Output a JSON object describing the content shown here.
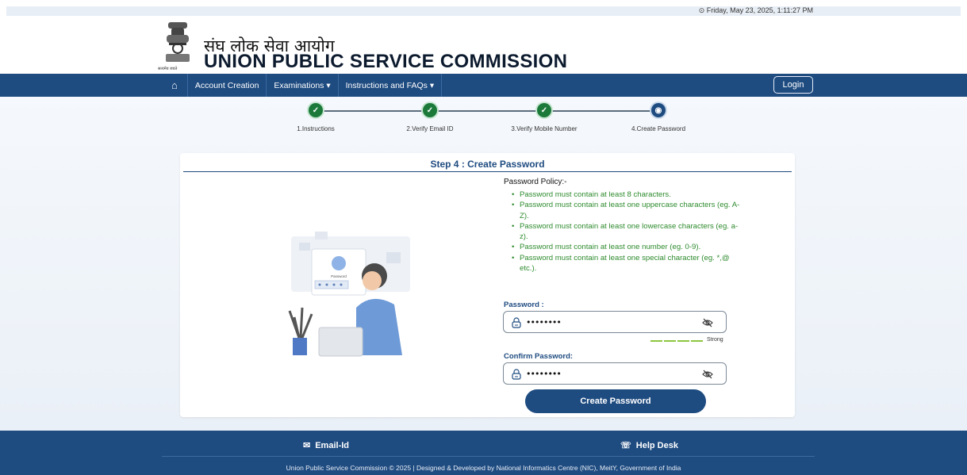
{
  "datetime": "Friday, May 23, 2025, 1:11:27 PM",
  "header": {
    "hindi_title": "संघ लोक सेवा आयोग",
    "english_title": "UNION PUBLIC SERVICE COMMISSION",
    "emblem_caption": "सत्यमेव जयते"
  },
  "nav": {
    "items": [
      {
        "label": "Account Creation"
      },
      {
        "label": "Examinations ▾"
      },
      {
        "label": "Instructions and FAQs ▾"
      }
    ],
    "login_label": "Login"
  },
  "steps": [
    {
      "label": "1.Instructions",
      "status": "done"
    },
    {
      "label": "2.Verify Email ID",
      "status": "done"
    },
    {
      "label": "3.Verify Mobile Number",
      "status": "done"
    },
    {
      "label": "4.Create Password",
      "status": "active"
    }
  ],
  "card": {
    "title": "Step 4 : Create Password",
    "policy_title": "Password Policy:-",
    "policy": [
      "Password must contain at least 8 characters.",
      "Password must contain at least one uppercase characters (eg. A-Z).",
      "Password must contain at least one lowercase characters (eg. a-z).",
      "Password must contain at least one number (eg. 0-9).",
      "Password must contain at least one special character (eg. *,@ etc.)."
    ],
    "password_label": "Password :",
    "password_value": "••••••••",
    "strength_label": "Strong",
    "confirm_label": "Confirm Password:",
    "confirm_value": "••••••••",
    "illustration_text": "Password",
    "submit_label": "Create Password"
  },
  "footer": {
    "email_label": "Email-Id",
    "helpdesk_label": "Help Desk",
    "copyright": "Union Public Service Commission © 2025 | Designed & Developed by National Informatics Centre (NIC), MeitY, Government of India"
  },
  "colors": {
    "primary": "#1e4b80",
    "success": "#1b7a3a",
    "policy_text": "#2e8b2e",
    "strength": "#8cc63f"
  }
}
